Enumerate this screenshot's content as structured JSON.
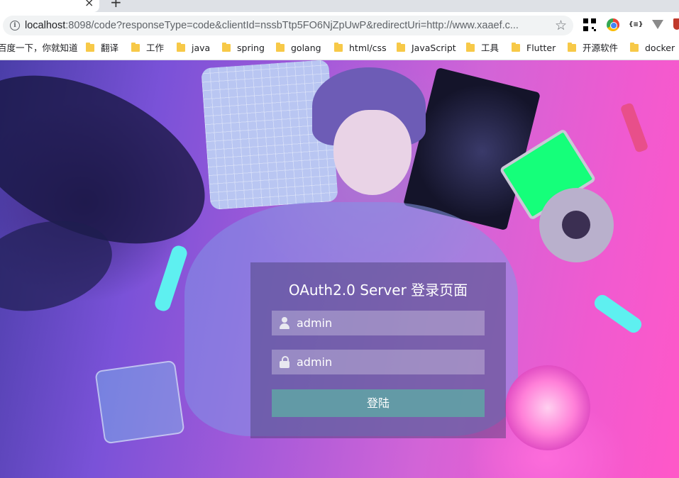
{
  "browser": {
    "url_host": "localhost",
    "url_rest": ":8098/code?responseType=code&clientId=nssbTtp5FO6NjZpUwP&redirectUri=http://www.xaaef.c...",
    "tab_close": "×",
    "new_tab": "+",
    "star": "☆",
    "info": "i",
    "json_ext": "{≡}"
  },
  "bookmarks": [
    {
      "label": "百度一下，你就知道",
      "folder": false
    },
    {
      "label": "翻译",
      "folder": true
    },
    {
      "label": "工作",
      "folder": true
    },
    {
      "label": "java",
      "folder": true
    },
    {
      "label": "spring",
      "folder": true
    },
    {
      "label": "golang",
      "folder": true
    },
    {
      "label": "html/css",
      "folder": true
    },
    {
      "label": "JavaScript",
      "folder": true
    },
    {
      "label": "工具",
      "folder": true
    },
    {
      "label": "Flutter",
      "folder": true
    },
    {
      "label": "开源软件",
      "folder": true
    },
    {
      "label": "docker",
      "folder": true
    }
  ],
  "login": {
    "title": "OAuth2.0 Server 登录页面",
    "username_value": "admin",
    "password_value": "admin",
    "submit_label": "登陆"
  }
}
